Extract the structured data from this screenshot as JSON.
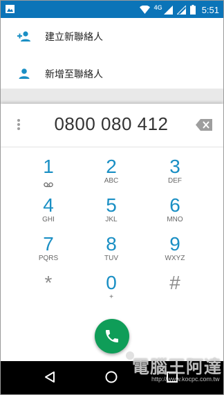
{
  "status_bar": {
    "network": "4G",
    "time": "5:51",
    "icons": [
      "gallery-icon",
      "wifi-icon",
      "signal-icon",
      "battery-icon"
    ]
  },
  "suggestions": [
    {
      "icon": "add-contact-icon",
      "label": "建立新聯絡人"
    },
    {
      "icon": "person-icon",
      "label": "新增至聯絡人"
    }
  ],
  "dialpad": {
    "digits": "0800 080 412",
    "keys": [
      {
        "num": "1",
        "sub": "voicemail"
      },
      {
        "num": "2",
        "sub": "ABC"
      },
      {
        "num": "3",
        "sub": "DEF"
      },
      {
        "num": "4",
        "sub": "GHI"
      },
      {
        "num": "5",
        "sub": "JKL"
      },
      {
        "num": "6",
        "sub": "MNO"
      },
      {
        "num": "7",
        "sub": "PQRS"
      },
      {
        "num": "8",
        "sub": "TUV"
      },
      {
        "num": "9",
        "sub": "WXYZ"
      },
      {
        "num": "*",
        "sub": ""
      },
      {
        "num": "0",
        "sub": "+"
      },
      {
        "num": "#",
        "sub": ""
      }
    ]
  },
  "watermark": {
    "text": "電腦王阿達",
    "url": "http://www.kocpc.com.tw"
  },
  "colors": {
    "status_bar": "#0b74b8",
    "accent": "#1a8fc4",
    "call_button": "#0f9d58"
  }
}
